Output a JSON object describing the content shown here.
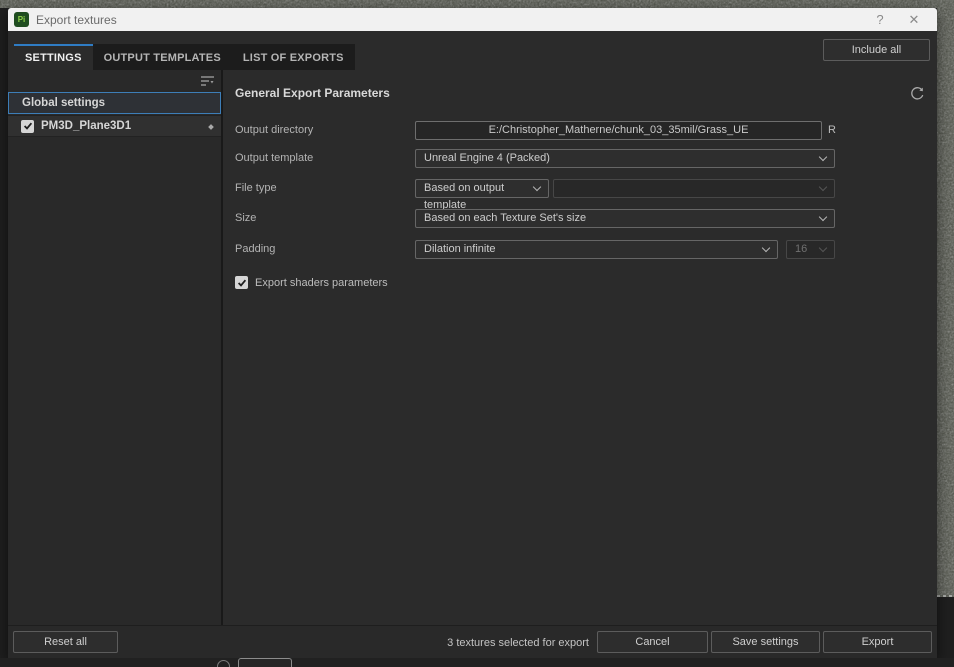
{
  "window": {
    "title": "Export textures",
    "app_icon_label": "Pi",
    "help_icon": "?",
    "close_icon": "✕"
  },
  "header": {
    "include_all_label": "Include all"
  },
  "tabs": [
    {
      "label": "SETTINGS",
      "active": true
    },
    {
      "label": "OUTPUT TEMPLATES",
      "active": false
    },
    {
      "label": "LIST OF EXPORTS",
      "active": false
    }
  ],
  "sidebar": {
    "items": [
      {
        "label": "Global settings",
        "selected": true
      },
      {
        "label": "PM3D_Plane3D1",
        "checked": true
      }
    ]
  },
  "content": {
    "section_title": "General Export Parameters",
    "rows": {
      "output_directory": {
        "label": "Output directory",
        "value": "E:/Christopher_Matherne/chunk_03_35mil/Grass_UE",
        "suffix_label": "R"
      },
      "output_template": {
        "label": "Output template",
        "value": "Unreal Engine 4 (Packed)"
      },
      "file_type": {
        "label": "File type",
        "value": "Based on output template",
        "secondary_value": ""
      },
      "size": {
        "label": "Size",
        "value": "Based on each Texture Set's size"
      },
      "padding": {
        "label": "Padding",
        "value": "Dilation infinite",
        "secondary_value": "16"
      },
      "export_shaders": {
        "label": "Export shaders parameters",
        "checked": true
      }
    }
  },
  "footer": {
    "reset_all_label": "Reset all",
    "status_text": "3 textures selected for export",
    "cancel_label": "Cancel",
    "save_settings_label": "Save settings",
    "export_label": "Export"
  },
  "colors": {
    "accent_blue": "#2f7cc4",
    "titlebar_bg": "#f1f1f1",
    "dialog_bg": "#2b2b2b",
    "panel_dark": "#1c1c1c",
    "app_icon_green": "#1f4d20",
    "app_icon_text_green": "#8fd34a",
    "grass_base": "#4b4e44"
  }
}
